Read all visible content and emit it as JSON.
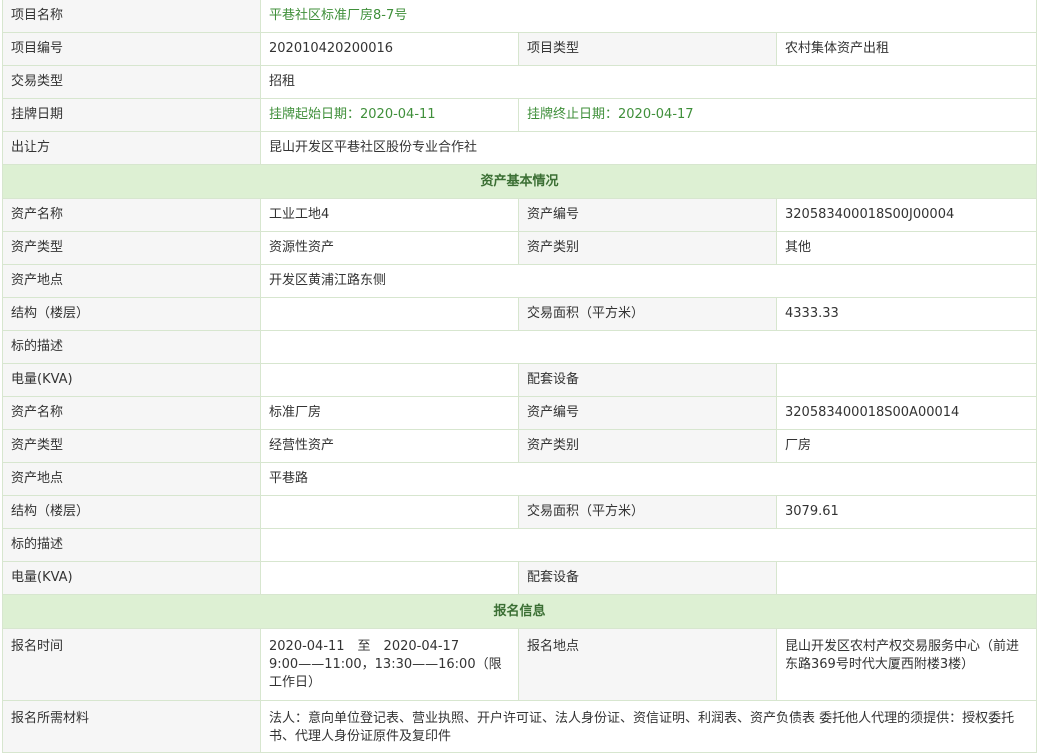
{
  "project": {
    "name_label": "项目名称",
    "name_value": "平巷社区标准厂房8-7号",
    "number_label": "项目编号",
    "number_value": "202010420200016",
    "type_label": "项目类型",
    "type_value": "农村集体资产出租",
    "trade_type_label": "交易类型",
    "trade_type_value": "招租",
    "listing_label": "挂牌日期",
    "listing_start": "挂牌起始日期：2020-04-11",
    "listing_end": "挂牌终止日期：2020-04-17",
    "transferor_label": "出让方",
    "transferor_value": "昆山开发区平巷社区股份专业合作社"
  },
  "asset_section_title": "资产基本情况",
  "assets": [
    {
      "name_label": "资产名称",
      "name_value": "工业工地4",
      "code_label": "资产编号",
      "code_value": "320583400018S00J00004",
      "type_label": "资产类型",
      "type_value": "资源性资产",
      "category_label": "资产类别",
      "category_value": "其他",
      "location_label": "资产地点",
      "location_value": "开发区黄浦江路东侧",
      "structure_label": "结构（楼层）",
      "structure_value": "",
      "area_label": "交易面积（平方米）",
      "area_value": "4333.33",
      "desc_label": "标的描述",
      "desc_value": "",
      "power_label": "电量(KVA)",
      "power_value": "",
      "equipment_label": "配套设备",
      "equipment_value": ""
    },
    {
      "name_label": "资产名称",
      "name_value": "标准厂房",
      "code_label": "资产编号",
      "code_value": "320583400018S00A00014",
      "type_label": "资产类型",
      "type_value": "经营性资产",
      "category_label": "资产类别",
      "category_value": "厂房",
      "location_label": "资产地点",
      "location_value": "平巷路",
      "structure_label": "结构（楼层）",
      "structure_value": "",
      "area_label": "交易面积（平方米）",
      "area_value": "3079.61",
      "desc_label": "标的描述",
      "desc_value": "",
      "power_label": "电量(KVA)",
      "power_value": "",
      "equipment_label": "配套设备",
      "equipment_value": ""
    }
  ],
  "registration_section_title": "报名信息",
  "registration": {
    "time_label": "报名时间",
    "time_line1": "2020-04-11　至　2020-04-17",
    "time_line2": "9:00——11:00，13:30——16:00（限工作日）",
    "place_label": "报名地点",
    "place_value": "昆山开发区农村产权交易服务中心（前进东路369号时代大厦西附楼3楼）",
    "materials_label": "报名所需材料",
    "materials_value": "法人：意向单位登记表、营业执照、开户许可证、法人身份证、资信证明、利润表、资产负债表 委托他人代理的须提供：授权委托书、代理人身份证原件及复印件"
  }
}
